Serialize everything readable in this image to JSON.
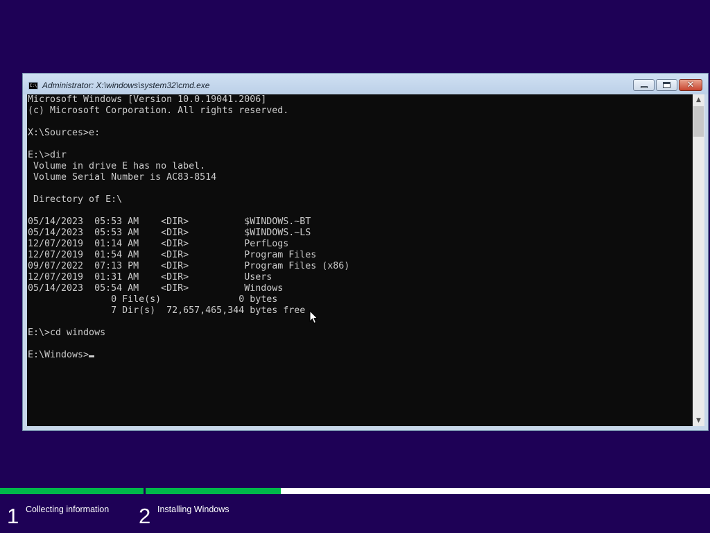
{
  "window": {
    "title": "Administrator: X:\\windows\\system32\\cmd.exe",
    "icon_text": "C:\\",
    "close_glyph": "✕"
  },
  "console": {
    "lines": [
      "Microsoft Windows [Version 10.0.19041.2006]",
      "(c) Microsoft Corporation. All rights reserved.",
      "",
      "X:\\Sources>e:",
      "",
      "E:\\>dir",
      " Volume in drive E has no label.",
      " Volume Serial Number is AC83-8514",
      "",
      " Directory of E:\\",
      "",
      "05/14/2023  05:53 AM    <DIR>          $WINDOWS.~BT",
      "05/14/2023  05:53 AM    <DIR>          $WINDOWS.~LS",
      "12/07/2019  01:14 AM    <DIR>          PerfLogs",
      "12/07/2019  01:54 AM    <DIR>          Program Files",
      "09/07/2022  07:13 PM    <DIR>          Program Files (x86)",
      "12/07/2019  01:31 AM    <DIR>          Users",
      "05/14/2023  05:54 AM    <DIR>          Windows",
      "               0 File(s)              0 bytes",
      "               7 Dir(s)  72,657,465,344 bytes free",
      "",
      "E:\\>cd windows",
      ""
    ],
    "prompt": "E:\\Windows>"
  },
  "scrollbar": {
    "up_glyph": "▲",
    "down_glyph": "▼"
  },
  "setup": {
    "steps": [
      {
        "number": "1",
        "label": "Collecting information",
        "progress": 1.0
      },
      {
        "number": "2",
        "label": "Installing Windows",
        "progress": 0.24
      }
    ]
  },
  "colors": {
    "background": "#1e0156",
    "console_bg": "#0c0c0c",
    "console_fg": "#cccccc",
    "progress_green": "#00b84a"
  }
}
